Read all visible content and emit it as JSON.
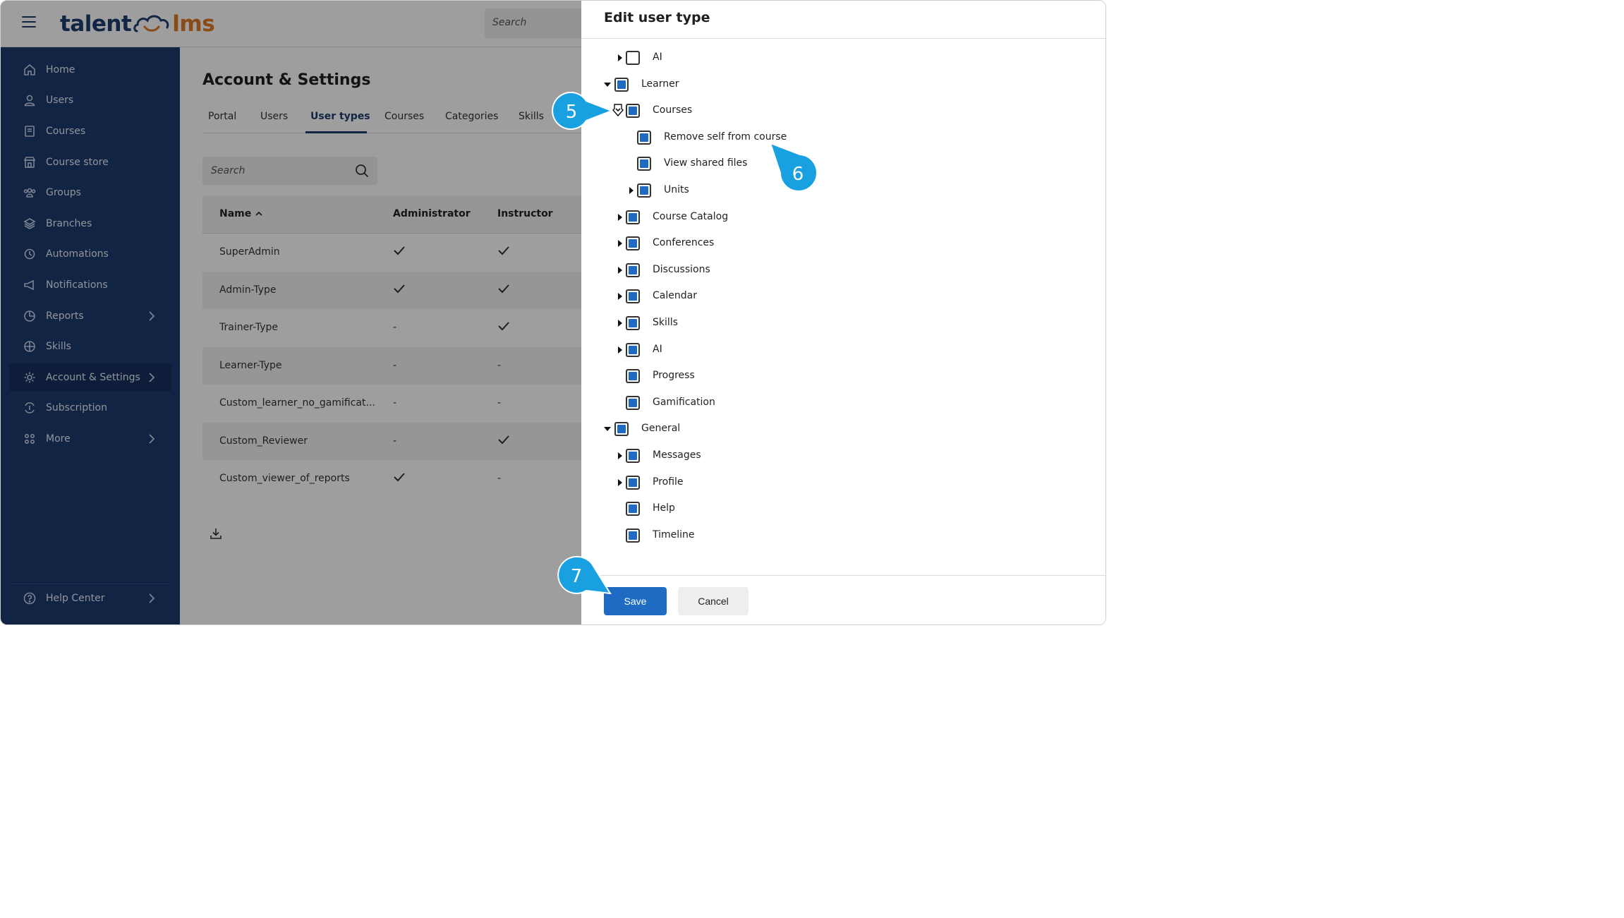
{
  "app": {
    "logo_left": "talent",
    "logo_right": "lms",
    "search_placeholder": "Search"
  },
  "sidebar": {
    "items": [
      {
        "label": "Home",
        "icon": "home-icon"
      },
      {
        "label": "Users",
        "icon": "user-icon"
      },
      {
        "label": "Courses",
        "icon": "book-icon"
      },
      {
        "label": "Course store",
        "icon": "store-icon"
      },
      {
        "label": "Groups",
        "icon": "groups-icon"
      },
      {
        "label": "Branches",
        "icon": "layers-icon"
      },
      {
        "label": "Automations",
        "icon": "automation-icon"
      },
      {
        "label": "Notifications",
        "icon": "megaphone-icon"
      },
      {
        "label": "Reports",
        "icon": "pie-chart-icon"
      },
      {
        "label": "Skills",
        "icon": "skills-icon"
      },
      {
        "label": "Account & Settings",
        "icon": "gear-icon"
      },
      {
        "label": "Subscription",
        "icon": "subscription-icon"
      },
      {
        "label": "More",
        "icon": "grid-icon"
      }
    ],
    "help_center": "Help Center"
  },
  "main": {
    "title": "Account & Settings",
    "tabs": [
      "Portal",
      "Users",
      "User types",
      "Courses",
      "Categories",
      "Skills"
    ],
    "active_tab": "User types",
    "search_placeholder": "Search",
    "table": {
      "headers": [
        "Name",
        "Administrator",
        "Instructor"
      ],
      "rows": [
        {
          "name": "SuperAdmin",
          "administrator": "check",
          "instructor": "check"
        },
        {
          "name": "Admin-Type",
          "administrator": "check",
          "instructor": "check"
        },
        {
          "name": "Trainer-Type",
          "administrator": "-",
          "instructor": "check"
        },
        {
          "name": "Learner-Type",
          "administrator": "-",
          "instructor": "-"
        },
        {
          "name": "Custom_learner_no_gamificat...",
          "administrator": "-",
          "instructor": "-"
        },
        {
          "name": "Custom_Reviewer",
          "administrator": "-",
          "instructor": "check"
        },
        {
          "name": "Custom_viewer_of_reports",
          "administrator": "check",
          "instructor": "-"
        }
      ]
    }
  },
  "drawer": {
    "title": "Edit user type",
    "tree": [
      {
        "label": "AI",
        "checked": false,
        "expander": "collapsed"
      },
      {
        "label": "Learner",
        "checked": true,
        "expander": "expanded"
      },
      {
        "label": "Courses",
        "checked": true,
        "expander": "expanded"
      },
      {
        "label": "Remove self from course",
        "checked": true,
        "expander": "none"
      },
      {
        "label": "View shared files",
        "checked": true,
        "expander": "none"
      },
      {
        "label": "Units",
        "checked": true,
        "expander": "collapsed"
      },
      {
        "label": "Course Catalog",
        "checked": true,
        "expander": "collapsed"
      },
      {
        "label": "Conferences",
        "checked": true,
        "expander": "collapsed"
      },
      {
        "label": "Discussions",
        "checked": true,
        "expander": "collapsed"
      },
      {
        "label": "Calendar",
        "checked": true,
        "expander": "collapsed"
      },
      {
        "label": "Skills",
        "checked": true,
        "expander": "collapsed"
      },
      {
        "label": "AI",
        "checked": true,
        "expander": "collapsed"
      },
      {
        "label": "Progress",
        "checked": true,
        "expander": "none"
      },
      {
        "label": "Gamification",
        "checked": true,
        "expander": "none"
      },
      {
        "label": "General",
        "checked": true,
        "expander": "expanded"
      },
      {
        "label": "Messages",
        "checked": true,
        "expander": "collapsed"
      },
      {
        "label": "Profile",
        "checked": true,
        "expander": "collapsed"
      },
      {
        "label": "Help",
        "checked": true,
        "expander": "none"
      },
      {
        "label": "Timeline",
        "checked": true,
        "expander": "none"
      }
    ],
    "save_label": "Save",
    "cancel_label": "Cancel"
  },
  "callouts": [
    "5",
    "6",
    "7"
  ],
  "colors": {
    "sidebar": "#1d3b6f",
    "accent": "#1f6bc4",
    "callout": "#18a0e0",
    "logo_orange": "#e07a23"
  }
}
